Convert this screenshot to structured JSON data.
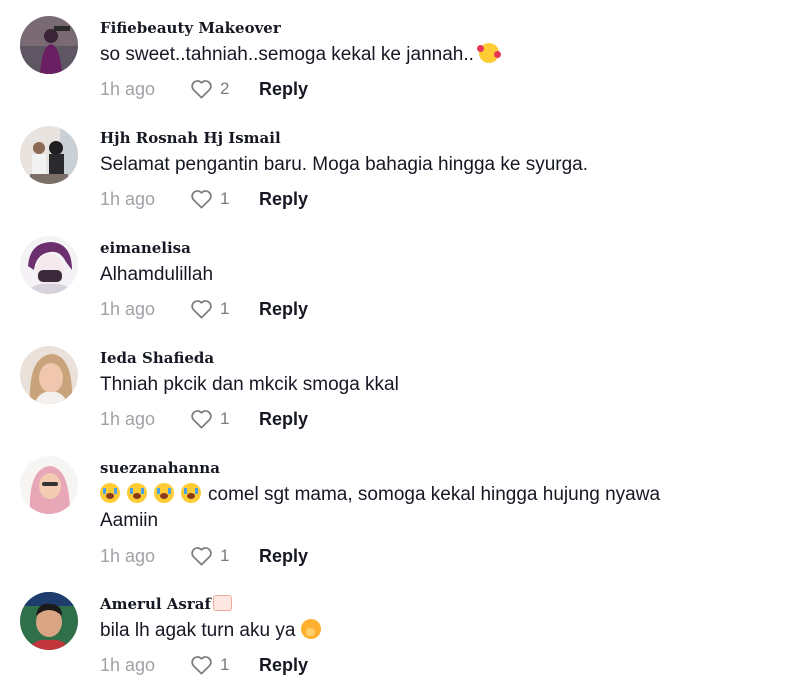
{
  "comments": [
    {
      "username": "Fifiebeauty Makeover",
      "text": "so sweet..tahniah..semoga kekal ke jannah..",
      "text_emoji": "smiling-face-with-hearts",
      "time": "1h ago",
      "likes": "2",
      "reply": "Reply"
    },
    {
      "username": "Hjh Rosnah Hj Ismail",
      "text": "Selamat pengantin baru. Moga bahagia hingga ke syurga.",
      "time": "1h ago",
      "likes": "1",
      "reply": "Reply"
    },
    {
      "username": "eimanelisa",
      "text": "Alhamdulillah",
      "time": "1h ago",
      "likes": "1",
      "reply": "Reply"
    },
    {
      "username": "Ieda Shafieda",
      "text": "Thniah pkcik dan mkcik smoga kkal",
      "time": "1h ago",
      "likes": "1",
      "reply": "Reply"
    },
    {
      "username": "suezanahanna",
      "text": "comel sgt mama, somoga kekal hingga hujung nyawa Aamiin",
      "text_emoji": "loudly-crying-face x4",
      "time": "1h ago",
      "likes": "1",
      "reply": "Reply"
    },
    {
      "username": "Amerul Asraf",
      "username_emoji": "label-tag",
      "text": "bila lh agak turn aku ya",
      "text_emoji": "face-with-hand-over-mouth",
      "time": "1h ago",
      "likes": "1",
      "reply": "Reply"
    }
  ],
  "colors": {
    "text": "#161823",
    "muted": "#a1a2a7",
    "like_icon": "#7b7c82"
  },
  "icons": {
    "like": "heart-outline-icon"
  }
}
